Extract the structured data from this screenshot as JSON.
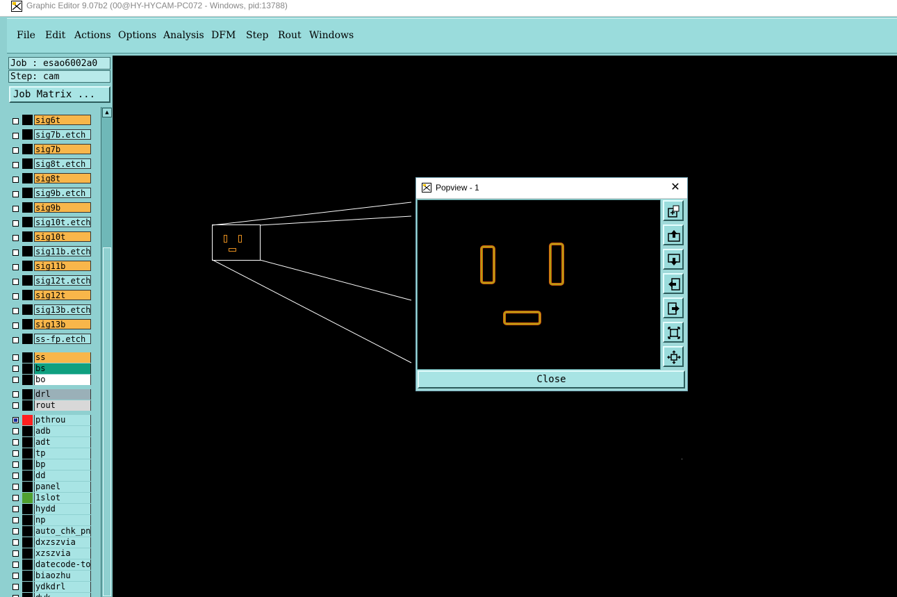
{
  "window": {
    "title": "Graphic Editor 9.07b2 (00@HY-HYCAM-PC072 - Windows, pid:13788)"
  },
  "menu": [
    {
      "label": "File"
    },
    {
      "label": "Edit"
    },
    {
      "label": "Actions"
    },
    {
      "label": "Options"
    },
    {
      "label": "Analysis"
    },
    {
      "label": "DFM"
    },
    {
      "label": "Step"
    },
    {
      "label": "Rout"
    },
    {
      "label": "Windows"
    }
  ],
  "panel": {
    "job": "Job : esao6002a0",
    "step": "Step: cam",
    "job_matrix_label": "Job Matrix ..."
  },
  "layers_signal": [
    {
      "name": "sig6t",
      "color": "#f8b64a"
    },
    {
      "name": "sig7b.etch",
      "color": "#a8e4e4"
    },
    {
      "name": "sig7b",
      "color": "#f8b64a"
    },
    {
      "name": "sig8t.etch",
      "color": "#a8e4e4"
    },
    {
      "name": "sig8t",
      "color": "#f8b64a"
    },
    {
      "name": "sig9b.etch",
      "color": "#a8e4e4"
    },
    {
      "name": "sig9b",
      "color": "#f8b64a"
    },
    {
      "name": "sig10t.etch",
      "color": "#a8e4e4"
    },
    {
      "name": "sig10t",
      "color": "#f8b64a"
    },
    {
      "name": "sig11b.etch",
      "color": "#a8e4e4"
    },
    {
      "name": "sig11b",
      "color": "#f8b64a"
    },
    {
      "name": "sig12t.etch",
      "color": "#a8e4e4"
    },
    {
      "name": "sig12t",
      "color": "#f8b64a"
    },
    {
      "name": "sig13b.etch",
      "color": "#a8e4e4"
    },
    {
      "name": "sig13b",
      "color": "#f8b64a"
    },
    {
      "name": "ss-fp.etch",
      "color": "#a8e4e4"
    }
  ],
  "layers_mask": [
    {
      "name": "ss",
      "color": "#f8b64a"
    },
    {
      "name": "bs",
      "color": "#10a080"
    },
    {
      "name": "bo",
      "color": "#ffffff"
    }
  ],
  "layers_drill": [
    {
      "name": "drl",
      "color": "#9ab0b8"
    },
    {
      "name": "rout",
      "color": "#d8d8d8"
    }
  ],
  "layers_misc": [
    {
      "name": "pthrou",
      "color": "#a8e4e4",
      "swatch": "#ff2020",
      "checked": true
    },
    {
      "name": "adb",
      "color": "#a8e4e4",
      "swatch": "#000000"
    },
    {
      "name": "adt",
      "color": "#a8e4e4",
      "swatch": "#000000"
    },
    {
      "name": "tp",
      "color": "#a8e4e4",
      "swatch": "#000000"
    },
    {
      "name": "bp",
      "color": "#a8e4e4",
      "swatch": "#000000"
    },
    {
      "name": "dd",
      "color": "#a8e4e4",
      "swatch": "#000000"
    },
    {
      "name": "panel",
      "color": "#a8e4e4",
      "swatch": "#000000"
    },
    {
      "name": "1slot",
      "color": "#a8e4e4",
      "swatch": "#50a030"
    },
    {
      "name": "hydd",
      "color": "#a8e4e4",
      "swatch": "#000000"
    },
    {
      "name": "np",
      "color": "#a8e4e4",
      "swatch": "#000000"
    },
    {
      "name": "auto_chk_pn",
      "color": "#a8e4e4",
      "swatch": "#000000"
    },
    {
      "name": "dxzszvia",
      "color": "#a8e4e4",
      "swatch": "#000000"
    },
    {
      "name": "xzszvia",
      "color": "#a8e4e4",
      "swatch": "#000000"
    },
    {
      "name": "datecode-to",
      "color": "#a8e4e4",
      "swatch": "#000000"
    },
    {
      "name": "biaozhu",
      "color": "#a8e4e4",
      "swatch": "#000000"
    },
    {
      "name": "ydkdrl",
      "color": "#a8e4e4",
      "swatch": "#000000"
    },
    {
      "name": "dwk",
      "color": "#a8e4e4",
      "swatch": "#000000"
    }
  ],
  "popview": {
    "title": "Popview - 1",
    "close_label": "Close",
    "tools": [
      "zoom-home-icon",
      "pan-up-icon",
      "pan-down-icon",
      "pan-left-icon",
      "pan-right-icon",
      "zoom-out-icon",
      "zoom-in-icon"
    ]
  }
}
